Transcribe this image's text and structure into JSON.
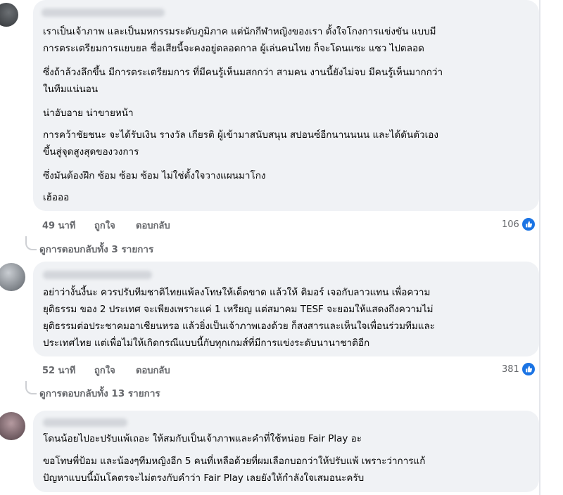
{
  "comments": [
    {
      "paragraphs": [
        [
          "เราเป็นเจ้าภาพ และเป็นมหกรรมระดับภูมิภาค แต่นักกีฬาหญิงของเรา ตั้งใจโกงการแข่งขัน แบบมี",
          "การตระเตรียมการแยบยล ชื่อเสียนี้จะคงอยู่ตลอดกาล ผู้เล่นคนไทย ก็จะโดนแซะ แซว ไปตลอด"
        ],
        [
          "ซึ่งถ้าล้วงลึกขึ้น มีการตระเตรียมการ ที่มีคนรู้เห็นมสกกว่า สามคน งานนี้ยังไม่จบ มีคนรู้เห็นมากกว่า",
          "ในทีมแน่นอน"
        ],
        [
          "น่าอับอาย น่าขายหน้า"
        ],
        [
          "การคว้าชัยชนะ จะได้รับเงิน รางวัล เกียรติ ผู้เข้ามาสนับสนุน สปอนซ์อีกนานนนน และได้ดันตัวเอง",
          "ขึ้นสู่จุดสูงสุดของวงการ"
        ],
        [
          "ซึ่งมันต้องฝึก ซ้อม ซ้อม ซ้อม ไม่ใช่ตั้งใจวางแผนมาโกง"
        ],
        [
          "เฮ้อออ"
        ]
      ],
      "time": "49 นาที",
      "like_label": "ถูกใจ",
      "reply_label": "ตอบกลับ",
      "reaction_count": "106",
      "view_replies": "ดูการตอบกลับทั้ง 3 รายการ"
    },
    {
      "paragraphs": [
        [
          "อย่าว่างั้นงี้นะ ควรปรับทีมชาติไทยแพ้ลงโทษให้เด็ดขาด แล้วให้ ติมอร์ เจอกับลาวแทน เพื่อความ",
          "ยุติธรรม ของ 2 ประเทศ จะเพียงเพราะแค่ 1 เหรียญ แต่สมาคม TESF จะยอมให้แสดงถึงความไม่",
          "ยุติธรรมต่อประชาคมอาเซียนหรอ แล้วยิ่งเป็นเจ้าภาพเองด้วย ก็สงสารและเห็นใจเพื่อนร่วมทีมและ",
          "ประเทศไทย แต่เพื่อไม่ให้เกิดกรณีแบบนี้กับทุกเกมส์ที่มีการแข่งระดับนานาชาติอีก"
        ]
      ],
      "time": "52 นาที",
      "like_label": "ถูกใจ",
      "reply_label": "ตอบกลับ",
      "reaction_count": "381",
      "view_replies": "ดูการตอบกลับทั้ง 13 รายการ"
    },
    {
      "paragraphs": [
        [
          "โดนน้อยไปอะปรับแพ้เถอะ ให้สมกับเป็นเจ้าภาพและคำที่ใช้หน่อย Fair Play อะ"
        ],
        [
          "ขอโทษพี่ป้อม และน้องๆทีมหญิงอีก 5 คนที่เหลือด้วยที่ผมเลือกบอกว่าให้ปรับแพ้ เพราะว่าการแก้",
          "ปัญหาแบบนี้มันโคตรจะไม่ตรงกับคำว่า Fair Play เลยยังให้กำลังใจเสมอนะครับ"
        ]
      ]
    }
  ]
}
